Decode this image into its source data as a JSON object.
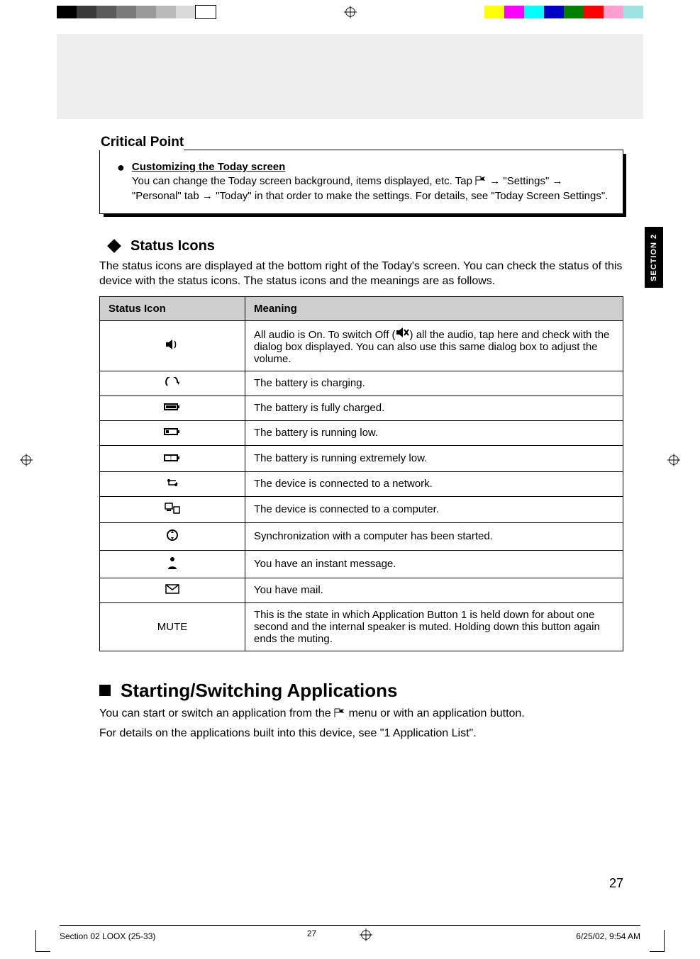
{
  "section_tab": "SECTION 2",
  "critical_point": {
    "title": "Critical Point",
    "heading": "Customizing the Today screen",
    "body_before_icon": "You can change the Today screen background, items displayed, etc. Tap ",
    "body_after_icon": " → \"Settings\" → \"Personal\" tab → \"Today\" in that order to make the settings. For details, see \"Today Screen Settings\"."
  },
  "status_icons": {
    "heading": "Status Icons",
    "intro": "The status icons are displayed at the bottom right of the Today's screen. You can check the status of this device with the status icons. The status icons and the meanings are as follows.",
    "columns": {
      "icon": "Status Icon",
      "meaning": "Meaning"
    },
    "rows": [
      {
        "icon": "speaker-on",
        "meaning_pre": "All audio is On. To switch Off (",
        "meaning_post": ") all the audio, tap here and check with the dialog box displayed. You can also use this same dialog box to adjust the volume."
      },
      {
        "icon": "battery-charging",
        "meaning": "The battery is charging."
      },
      {
        "icon": "battery-full",
        "meaning": "The battery is fully charged."
      },
      {
        "icon": "battery-low",
        "meaning": "The battery is running low."
      },
      {
        "icon": "battery-very-low",
        "meaning": "The battery is running extremely low."
      },
      {
        "icon": "network",
        "meaning": "The device is connected to a network."
      },
      {
        "icon": "connected-pc",
        "meaning": "The device is connected to a computer."
      },
      {
        "icon": "sync",
        "meaning": "Synchronization with a computer has been started."
      },
      {
        "icon": "im",
        "meaning": "You have an instant message."
      },
      {
        "icon": "mail",
        "meaning": "You have mail."
      },
      {
        "icon_text": "MUTE",
        "meaning": "This is the state in which Application Button 1 is held down for about one second and the internal speaker is muted. Holding down this button again ends the muting."
      }
    ]
  },
  "starting": {
    "heading": "Starting/Switching Applications",
    "p1_before": "You can start or switch an application from the ",
    "p1_after": " menu or with an application button.",
    "p2": "For details on the applications built into this device, see \"1 Application List\"."
  },
  "page_number": "27",
  "slug": {
    "left": "Section 02 LOOX (25-33)",
    "mid": "27",
    "right": "6/25/02, 9:54 AM"
  },
  "swatches_left": [
    "#000000",
    "#3a3a3a",
    "#5a5a5a",
    "#7a7a7a",
    "#9a9a9a",
    "#bababa",
    "#dadada",
    "#ffffff"
  ],
  "swatches_right": [
    "#ffff00",
    "#ff00ff",
    "#00ffff",
    "#0000c8",
    "#008000",
    "#ff0000",
    "#ff9ecf",
    "#9de3e3"
  ]
}
